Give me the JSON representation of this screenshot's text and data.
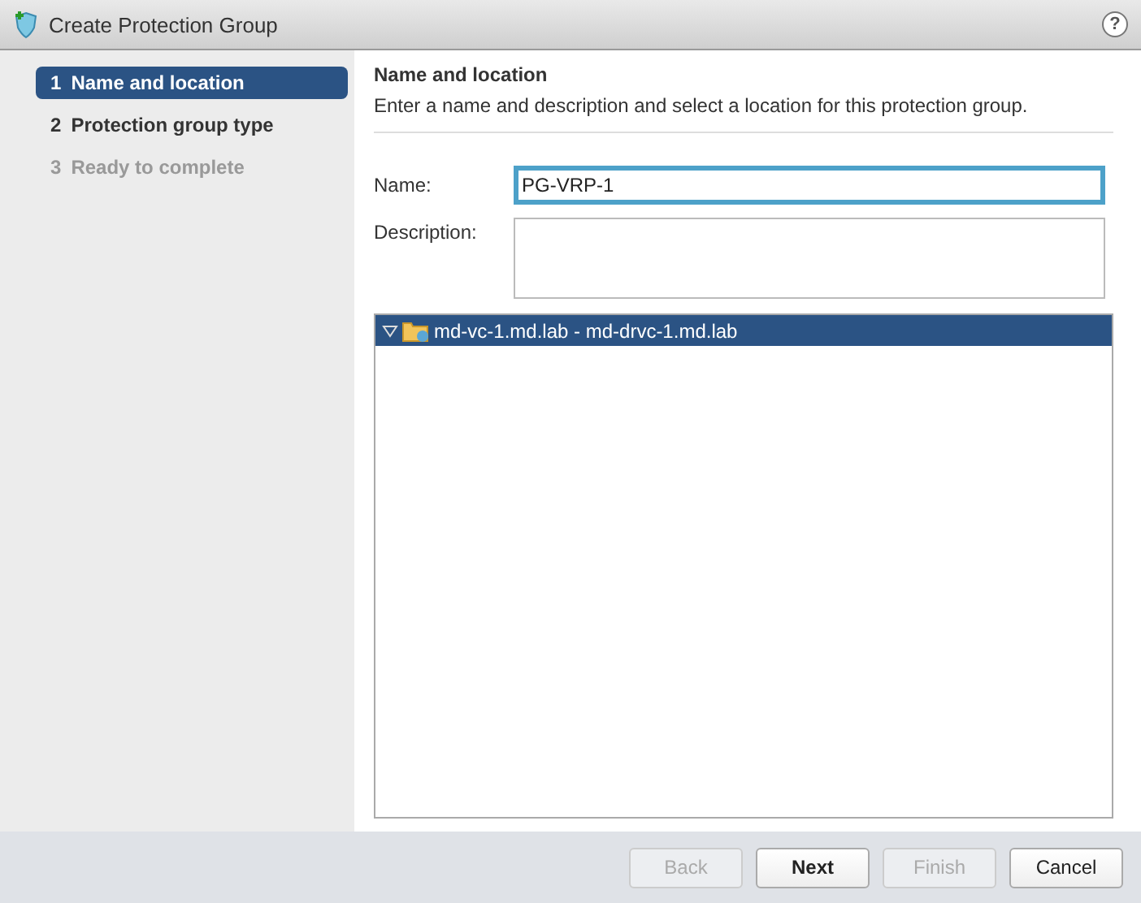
{
  "window": {
    "title": "Create Protection Group",
    "help": "?"
  },
  "steps": [
    {
      "number": "1",
      "label": "Name and location",
      "selected": true,
      "disabled": false
    },
    {
      "number": "2",
      "label": "Protection group type",
      "selected": false,
      "disabled": false
    },
    {
      "number": "3",
      "label": "Ready to complete",
      "selected": false,
      "disabled": true
    }
  ],
  "page": {
    "heading": "Name and location",
    "subtitle": "Enter a name and description and select a location for this protection group."
  },
  "form": {
    "name_label": "Name:",
    "name_value": "PG-VRP-1",
    "description_label": "Description:"
  },
  "tree": [
    {
      "label": "md-vc-1.md.lab - md-drvc-1.md.lab",
      "expanded": true,
      "selected": true
    }
  ],
  "buttons": [
    {
      "label": "Back",
      "disabled": true,
      "primary": false
    },
    {
      "label": "Next",
      "disabled": false,
      "primary": true
    },
    {
      "label": "Finish",
      "disabled": true,
      "primary": false
    },
    {
      "label": "Cancel",
      "disabled": false,
      "primary": false
    }
  ]
}
